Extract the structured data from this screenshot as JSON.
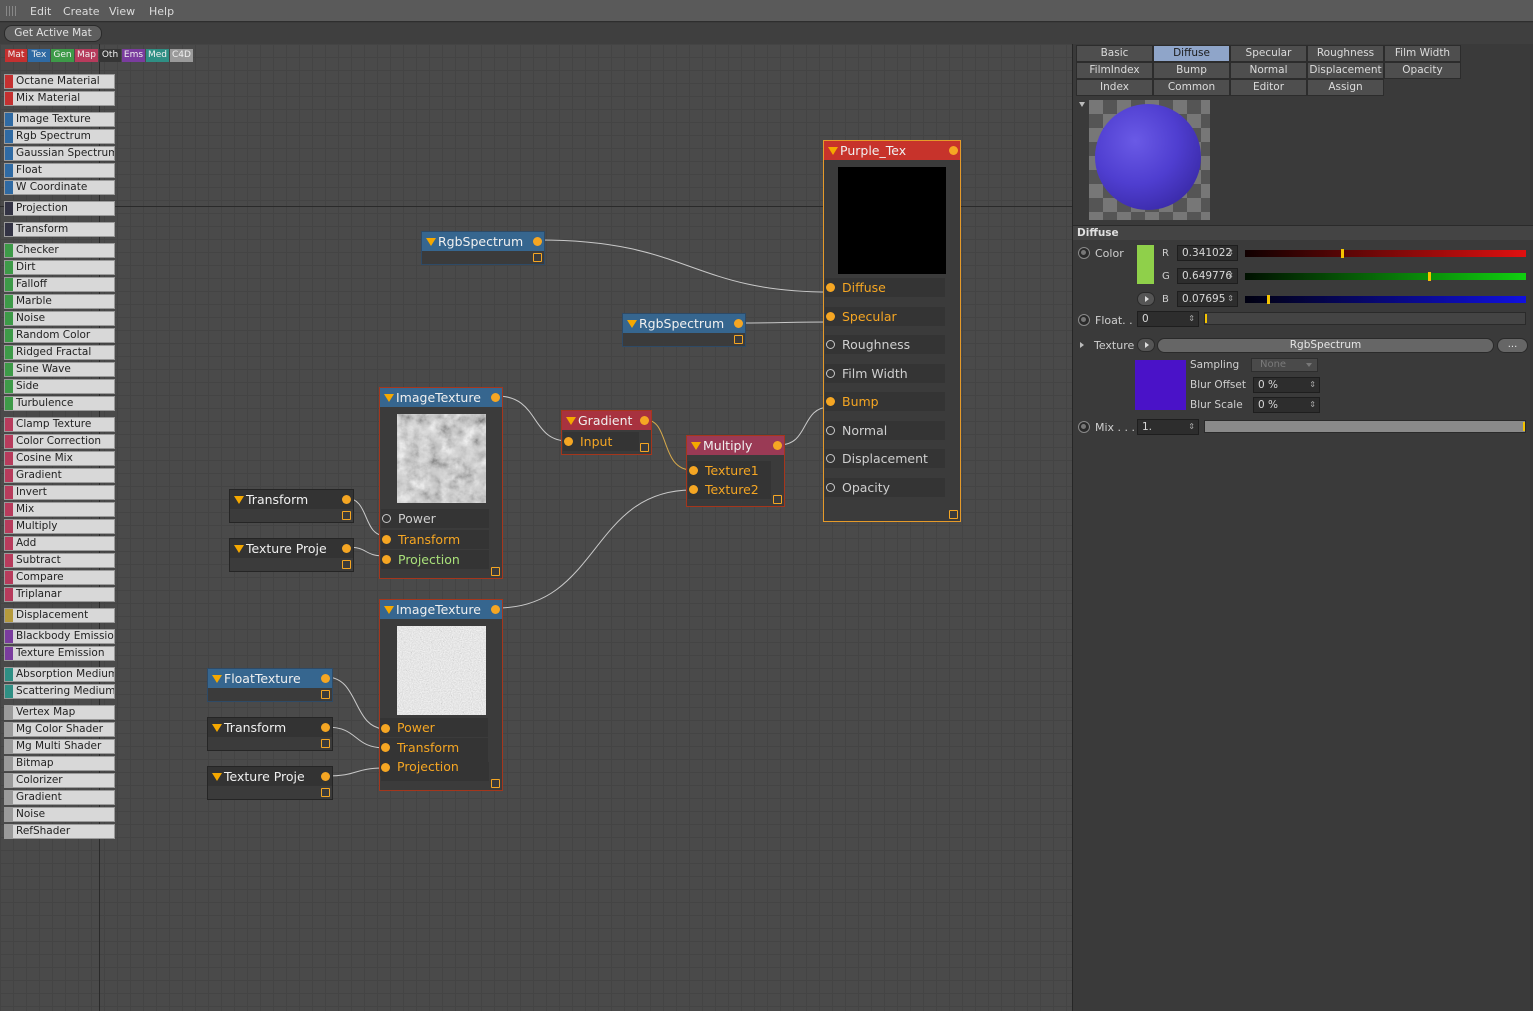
{
  "menu": [
    "Edit",
    "Create",
    "View",
    "Help"
  ],
  "toolbar": {
    "get_active_mat": "Get Active Mat"
  },
  "categories": [
    {
      "label": "Mat",
      "color": "#c43030"
    },
    {
      "label": "Tex",
      "color": "#2f6aa3"
    },
    {
      "label": "Gen",
      "color": "#3d9a48"
    },
    {
      "label": "Map",
      "color": "#b73b5c"
    },
    {
      "label": "Oth",
      "color": "#353535"
    },
    {
      "label": "Ems",
      "color": "#7a3c9e"
    },
    {
      "label": "Med",
      "color": "#2f8f84"
    },
    {
      "label": "C4D",
      "color": "#9a9a9a"
    }
  ],
  "palette": [
    {
      "label": "Octane Material",
      "color": "#c43030"
    },
    {
      "label": "Mix Material",
      "color": "#c43030"
    },
    {
      "label": "Image Texture",
      "color": "#2f6aa3"
    },
    {
      "label": "Rgb Spectrum",
      "color": "#2f6aa3"
    },
    {
      "label": "Gaussian Spectrum",
      "color": "#2f6aa3"
    },
    {
      "label": "Float",
      "color": "#2f6aa3"
    },
    {
      "label": "W Coordinate",
      "color": "#2f6aa3"
    },
    {
      "label": "Projection",
      "color": "#333344"
    },
    {
      "label": "Transform",
      "color": "#333344"
    },
    {
      "label": "Checker",
      "color": "#3d9a48"
    },
    {
      "label": "Dirt",
      "color": "#3d9a48"
    },
    {
      "label": "Falloff",
      "color": "#3d9a48"
    },
    {
      "label": "Marble",
      "color": "#3d9a48"
    },
    {
      "label": "Noise",
      "color": "#3d9a48"
    },
    {
      "label": "Random Color",
      "color": "#3d9a48"
    },
    {
      "label": "Ridged Fractal",
      "color": "#3d9a48"
    },
    {
      "label": "Sine Wave",
      "color": "#3d9a48"
    },
    {
      "label": "Side",
      "color": "#3d9a48"
    },
    {
      "label": "Turbulence",
      "color": "#3d9a48"
    },
    {
      "label": "Clamp Texture",
      "color": "#b73b5c"
    },
    {
      "label": "Color Correction",
      "color": "#b73b5c"
    },
    {
      "label": "Cosine Mix",
      "color": "#b73b5c"
    },
    {
      "label": "Gradient",
      "color": "#b73b5c"
    },
    {
      "label": "Invert",
      "color": "#b73b5c"
    },
    {
      "label": "Mix",
      "color": "#b73b5c"
    },
    {
      "label": "Multiply",
      "color": "#b73b5c"
    },
    {
      "label": "Add",
      "color": "#b73b5c"
    },
    {
      "label": "Subtract",
      "color": "#b73b5c"
    },
    {
      "label": "Compare",
      "color": "#b73b5c"
    },
    {
      "label": "Triplanar",
      "color": "#b73b5c"
    },
    {
      "label": "Displacement",
      "color": "#b59a3c"
    },
    {
      "label": "Blackbody Emission",
      "color": "#7a3c9e"
    },
    {
      "label": "Texture Emission",
      "color": "#7a3c9e"
    },
    {
      "label": "Absorption Medium",
      "color": "#2f8f84"
    },
    {
      "label": "Scattering Medium",
      "color": "#2f8f84"
    },
    {
      "label": "Vertex Map",
      "color": "#9a9a9a"
    },
    {
      "label": "Mg Color Shader",
      "color": "#9a9a9a"
    },
    {
      "label": "Mg Multi Shader",
      "color": "#9a9a9a"
    },
    {
      "label": "Bitmap",
      "color": "#9a9a9a"
    },
    {
      "label": "Colorizer",
      "color": "#9a9a9a"
    },
    {
      "label": "Gradient",
      "color": "#9a9a9a"
    },
    {
      "label": "Noise",
      "color": "#9a9a9a"
    },
    {
      "label": "RefShader",
      "color": "#9a9a9a"
    }
  ],
  "nodes": {
    "rgb1": {
      "title": "RgbSpectrum"
    },
    "rgb2": {
      "title": "RgbSpectrum"
    },
    "img1": {
      "title": "ImageTexture",
      "pins": [
        "Power",
        "Transform",
        "Projection"
      ]
    },
    "img2": {
      "title": "ImageTexture",
      "pins": [
        "Power",
        "Transform",
        "Projection"
      ]
    },
    "gradient": {
      "title": "Gradient",
      "pins": [
        "Input"
      ]
    },
    "multiply": {
      "title": "Multiply",
      "pins": [
        "Texture1",
        "Texture2"
      ]
    },
    "transform1": {
      "title": "Transform"
    },
    "proj1": {
      "title": "Texture Proje"
    },
    "floattex": {
      "title": "FloatTexture"
    },
    "transform2": {
      "title": "Transform"
    },
    "proj2": {
      "title": "Texture Proje"
    },
    "material": {
      "title": "Purple_Tex",
      "pins": [
        "Diffuse",
        "Specular",
        "Roughness",
        "Film Width",
        "Bump",
        "Normal",
        "Displacement",
        "Opacity"
      ]
    }
  },
  "panel": {
    "tabs": [
      "Basic",
      "Diffuse",
      "Specular",
      "Roughness",
      "Film Width",
      "FilmIndex",
      "Bump",
      "Normal",
      "Displacement",
      "Opacity",
      "Index",
      "Common",
      "Editor",
      "Assign"
    ],
    "active_tab": "Diffuse",
    "section": "Diffuse",
    "color_label": "Color",
    "r_label": "R",
    "r_value": "0.341022",
    "g_label": "G",
    "g_value": "0.649776",
    "b_label": "B",
    "b_value": "0.07695",
    "float_label": "Float. .",
    "float_value": "0",
    "texture_label": "Texture",
    "texture_value": "RgbSpectrum",
    "texture_more": "...",
    "sampling_label": "Sampling",
    "sampling_value": "None",
    "blur_offset_label": "Blur Offset",
    "blur_offset_value": "0 %",
    "blur_scale_label": "Blur Scale",
    "blur_scale_value": "0 %",
    "mix_label": "Mix . . .",
    "mix_value": "1.",
    "swatch_color": "#8fd04a",
    "texture_swatch_color": "#4a12c8",
    "r_level": 0.341022,
    "g_level": 0.649776,
    "b_level": 0.07695
  }
}
